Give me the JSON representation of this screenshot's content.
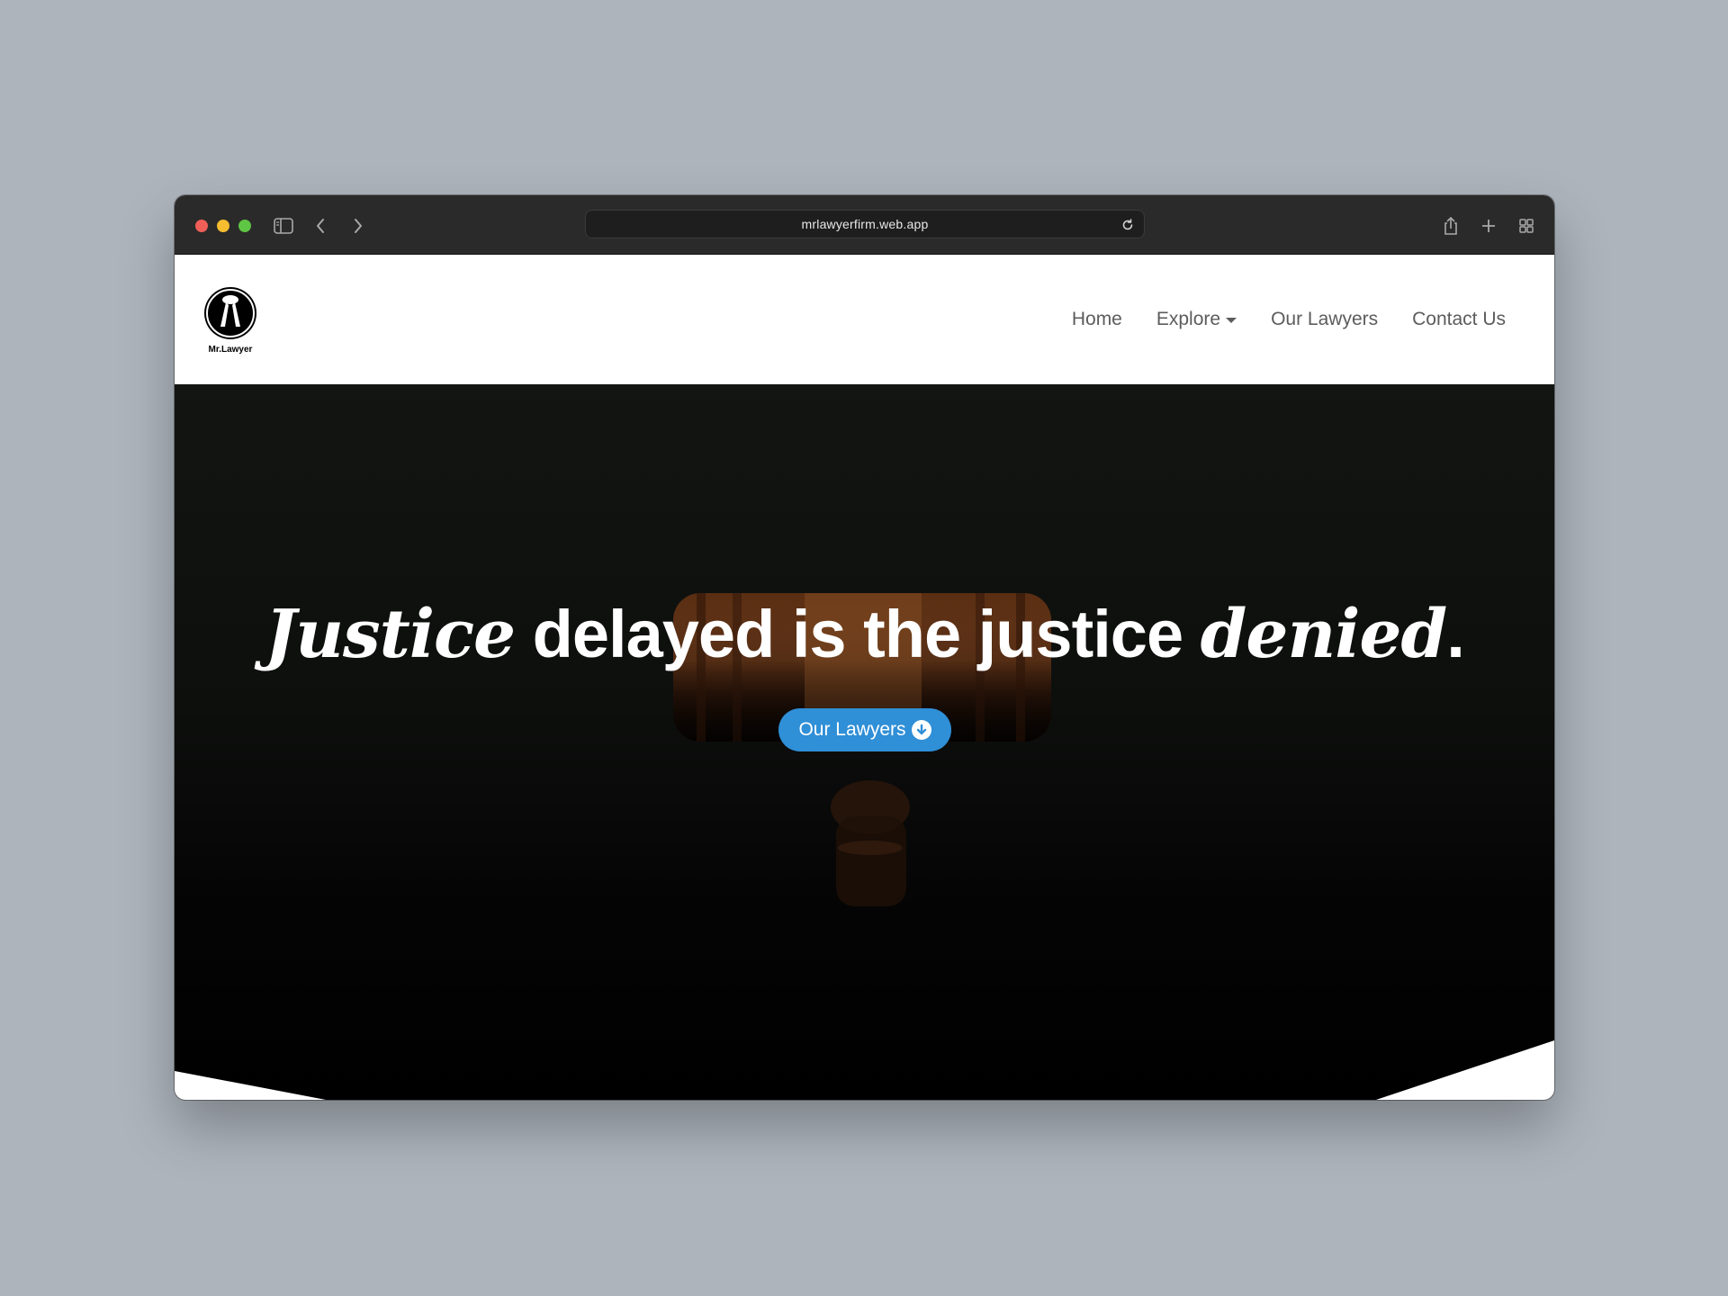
{
  "browser": {
    "url": "mrlawyerfirm.web.app",
    "icons": [
      "sidebar-icon",
      "back-icon",
      "forward-icon",
      "reload-icon",
      "share-icon",
      "new-tab-icon",
      "tab-overview-icon"
    ]
  },
  "site": {
    "logo_text": "Mr.Lawyer",
    "nav": {
      "home": "Home",
      "explore": "Explore",
      "our_lawyers": "Our Lawyers",
      "contact": "Contact Us"
    }
  },
  "hero": {
    "title_part1": "Justice",
    "title_part2": " delayed is the justice ",
    "title_part3": "denied",
    "title_part4": ".",
    "cta_label": "Our Lawyers",
    "cta_icon": "arrow-circle-down-icon"
  },
  "colors": {
    "accent": "#2f8fd7",
    "nav_text": "#5c5c5c",
    "chrome_bg": "#2b2a2a",
    "desktop_bg": "#adb4bc"
  }
}
